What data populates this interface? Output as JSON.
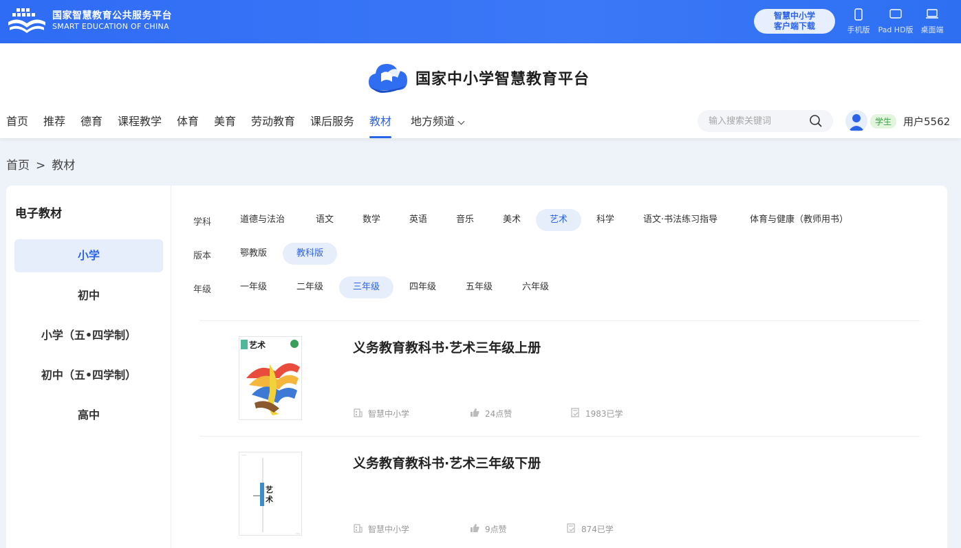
{
  "topbar": {
    "platform_name": "国家智慧教育公共服务平台",
    "platform_name_en": "SMART EDUCATION OF CHINA",
    "download_line1": "智慧中小学",
    "download_line2": "客户端下载",
    "devices": [
      {
        "label": "手机版",
        "icon": "phone-icon"
      },
      {
        "label": "Pad HD版",
        "icon": "tablet-icon"
      },
      {
        "label": "桌面端",
        "icon": "laptop-icon"
      }
    ]
  },
  "header": {
    "brand_title": "国家中小学智慧教育平台",
    "nav": [
      "首页",
      "推荐",
      "德育",
      "课程教学",
      "体育",
      "美育",
      "劳动教育",
      "课后服务",
      "教材",
      "地方频道"
    ],
    "nav_active": "教材",
    "search_placeholder": "输入搜索关键词",
    "user_role": "学生",
    "user_name": "用户5562"
  },
  "breadcrumb": {
    "home": "首页",
    "sep": ">",
    "current": "教材"
  },
  "sidebar": {
    "title": "电子教材",
    "items": [
      "小学",
      "初中",
      "小学（五•四学制）",
      "初中（五•四学制）",
      "高中"
    ],
    "active": "小学"
  },
  "filters": {
    "subject": {
      "label": "学科",
      "options": [
        "道德与法治",
        "语文",
        "数学",
        "英语",
        "音乐",
        "美术",
        "艺术",
        "科学",
        "语文·书法练习指导",
        "体育与健康（教师用书）"
      ],
      "active": "艺术"
    },
    "edition": {
      "label": "版本",
      "options": [
        "鄂教版",
        "教科版"
      ],
      "active": "教科版"
    },
    "grade": {
      "label": "年级",
      "options": [
        "一年级",
        "二年级",
        "三年级",
        "四年级",
        "五年级",
        "六年级"
      ],
      "active": "三年级"
    }
  },
  "books": [
    {
      "title": "义务教育教科书·艺术三年级上册",
      "source": "智慧中小学",
      "likes": "24点赞",
      "learned": "1983已学"
    },
    {
      "title": "义务教育教科书·艺术三年级下册",
      "source": "智慧中小学",
      "likes": "9点赞",
      "learned": "874已学"
    }
  ],
  "colors": {
    "primary": "#2a62e8",
    "banner": "#2f6cf5",
    "active_bg": "#e6eefc"
  }
}
